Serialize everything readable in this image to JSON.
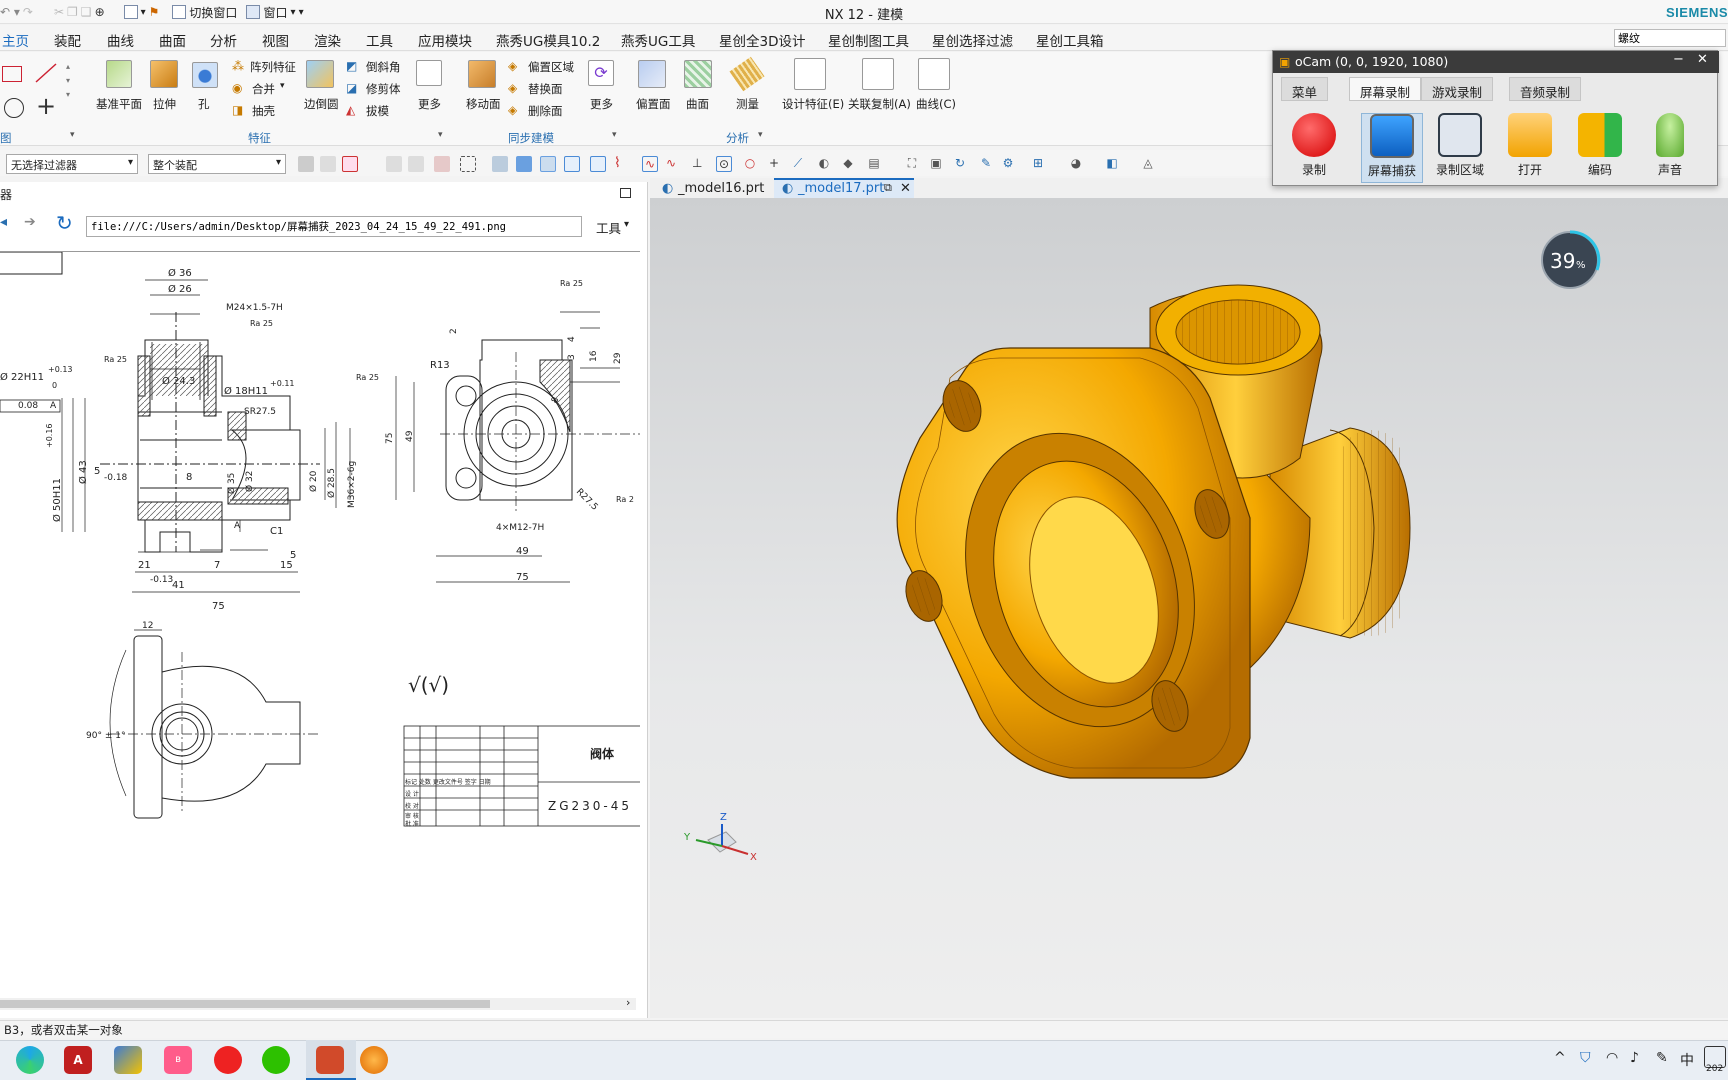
{
  "window": {
    "title": "NX 12 - 建模",
    "brand": "SIEMENS"
  },
  "quick_access": {
    "switch_window": "切换窗口",
    "window": "窗口"
  },
  "menu": {
    "items": [
      "主页",
      "装配",
      "曲线",
      "曲面",
      "分析",
      "视图",
      "渲染",
      "工具",
      "应用模块",
      "燕秀UG模具10.2",
      "燕秀UG工具",
      "星创全3D设计",
      "星创制图工具",
      "星创选择过滤",
      "星创工具箱"
    ],
    "search_value": "螺纹"
  },
  "ribbon": {
    "buttons": {
      "datum_plane": "基准平面",
      "extrude": "拉伸",
      "hole": "孔",
      "pattern_feature": "阵列特征",
      "unite": "合并",
      "shell": "抽壳",
      "edge_blend": "边倒圆",
      "chamfer": "倒斜角",
      "trim_body": "修剪体",
      "draft": "拔模",
      "more1": "更多",
      "move_face": "移动面",
      "offset_region": "偏置区域",
      "replace_face": "替换面",
      "delete_face": "删除面",
      "more2": "更多",
      "offset_face": "偏置面",
      "surface": "曲面",
      "measure": "测量",
      "design_feature": "设计特征(E)",
      "associative_copy": "关联复制(A)",
      "curve": "曲线(C)"
    },
    "groups": {
      "sketch_tail": "图",
      "feature": "特征",
      "sync_modeling": "同步建模",
      "analysis": "分析"
    }
  },
  "filters": {
    "type_filter": "无选择过滤器",
    "scope": "整个装配"
  },
  "left_panel": {
    "header": "器",
    "url": "file:///C:/Users/admin/Desktop/屏幕捕获_2023_04_24_15_49_22_491.png",
    "tools": "工具"
  },
  "drawing": {
    "dims": {
      "d36": "Ø 36",
      "d26": "Ø 26",
      "m24": "M24×1.5-7H",
      "ra25": "Ra 25",
      "d24_3": "Ø 24.3",
      "d22": "Ø 22H11",
      "tol013": "+0.13",
      "zero": "0",
      "d18": "Ø 18H11",
      "tol011": "+0.11",
      "sr27": "SR27.5",
      "d50": "Ø 50H11",
      "tol016": "+0.16",
      "d43": "Ø 43",
      "d35": "Ø 35",
      "d32": "Ø 32",
      "d20": "Ø 20",
      "d28": "Ø 28.5",
      "m36": "M36×2-6g",
      "n5": "5",
      "neg018": "-0.18",
      "n8": "8",
      "n21": "21",
      "neg013": "-0.13",
      "n7": "7",
      "n15": "15",
      "n41": "41",
      "n75": "75",
      "c1": "C1",
      "flat": "0.08",
      "datumA": "A",
      "r13": "R13",
      "n2": "2",
      "n4": "4",
      "n16": "16",
      "n29": "29",
      "n49": "49",
      "r27": "R27.5",
      "hole4": "4×M12-7H",
      "n12": "12",
      "angle": "90° ± 1°",
      "ra2": "Ra 2",
      "n3": "3",
      "n8b": "8"
    },
    "roughness_note": "√(√)",
    "titleblock": {
      "name": "阀体",
      "material": "ZG230-45",
      "rows": [
        "标记 处数 更改文件号 签字 日期",
        "设 计",
        "校 对",
        "审 核",
        "批 准"
      ]
    }
  },
  "graphics": {
    "tabs": [
      "_model16.prt",
      "_model17.prt"
    ],
    "progress_percent": "39",
    "progress_suffix": "%",
    "triad": {
      "x": "X",
      "y": "Y",
      "z": "Z"
    }
  },
  "status": {
    "prompt": "B3，或者双击某一对象"
  },
  "ocam": {
    "title": "oCam (0, 0, 1920, 1080)",
    "tabs": [
      "菜单",
      "屏幕录制",
      "游戏录制",
      "音频录制"
    ],
    "buttons": [
      "录制",
      "屏幕捕获",
      "录制区域",
      "打开",
      "编码",
      "声音"
    ]
  },
  "taskbar": {
    "ime": "中",
    "clock": "202"
  },
  "colors": {
    "accent": "#1b6bbf",
    "model": "#f2a300",
    "siemens": "#1a8aa8"
  }
}
